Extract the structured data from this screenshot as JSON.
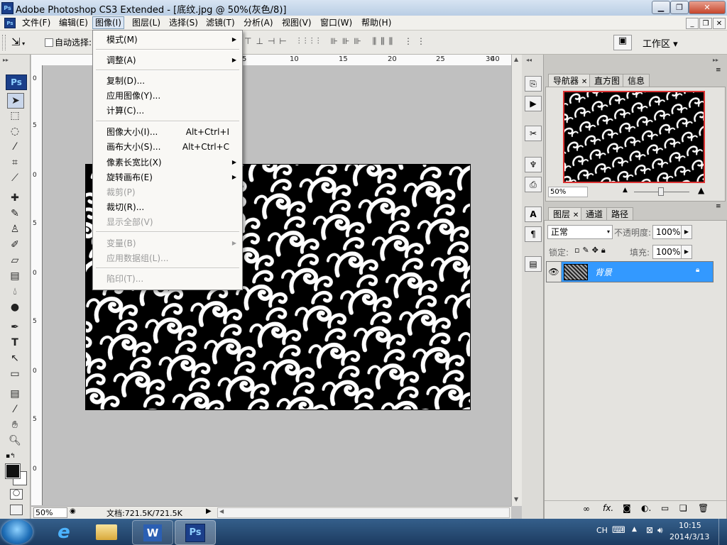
{
  "window": {
    "title": "Adobe Photoshop CS3 Extended - [底纹.jpg @ 50%(灰色/8)]",
    "app_icon": "Ps"
  },
  "menubar": {
    "items": [
      "文件(F)",
      "编辑(E)",
      "图像(I)",
      "图层(L)",
      "选择(S)",
      "滤镜(T)",
      "分析(A)",
      "视图(V)",
      "窗口(W)",
      "帮助(H)"
    ],
    "active": "图像(I)"
  },
  "options": {
    "auto_select_label": "自动选择:",
    "workspace_label": "工作区 ▾"
  },
  "image_menu": {
    "items": [
      {
        "label": "模式(M)",
        "submenu": true,
        "disabled": false,
        "shortcut": ""
      },
      {
        "label": "调整(A)",
        "submenu": true,
        "disabled": false,
        "shortcut": ""
      },
      {
        "label": "复制(D)...",
        "submenu": false,
        "disabled": false,
        "shortcut": ""
      },
      {
        "label": "应用图像(Y)...",
        "submenu": false,
        "disabled": false,
        "shortcut": ""
      },
      {
        "label": "计算(C)...",
        "submenu": false,
        "disabled": false,
        "shortcut": ""
      },
      {
        "label": "图像大小(I)...",
        "submenu": false,
        "disabled": false,
        "shortcut": "Alt+Ctrl+I"
      },
      {
        "label": "画布大小(S)...",
        "submenu": false,
        "disabled": false,
        "shortcut": "Alt+Ctrl+C"
      },
      {
        "label": "像素长宽比(X)",
        "submenu": true,
        "disabled": false,
        "shortcut": ""
      },
      {
        "label": "旋转画布(E)",
        "submenu": true,
        "disabled": false,
        "shortcut": ""
      },
      {
        "label": "裁剪(P)",
        "submenu": false,
        "disabled": true,
        "shortcut": ""
      },
      {
        "label": "裁切(R)...",
        "submenu": false,
        "disabled": false,
        "shortcut": ""
      },
      {
        "label": "显示全部(V)",
        "submenu": false,
        "disabled": true,
        "shortcut": ""
      },
      {
        "label": "变量(B)",
        "submenu": true,
        "disabled": true,
        "shortcut": ""
      },
      {
        "label": "应用数据组(L)...",
        "submenu": false,
        "disabled": true,
        "shortcut": ""
      },
      {
        "label": "陷印(T)...",
        "submenu": false,
        "disabled": true,
        "shortcut": ""
      }
    ]
  },
  "rulers": {
    "top": [
      "5",
      "10",
      "15",
      "20",
      "25",
      "30",
      "35",
      "40"
    ],
    "left": [
      "0",
      "5",
      "0",
      "5",
      "0",
      "5",
      "0",
      "5",
      "0",
      "5",
      "0",
      "2",
      "3",
      "0"
    ]
  },
  "statusbar": {
    "zoom": "50%",
    "doc_info": "文档:721.5K/721.5K"
  },
  "navigator_panel": {
    "tabs": [
      "导航器",
      "直方图",
      "信息"
    ],
    "zoom": "50%"
  },
  "layers_panel": {
    "tabs": [
      "图层",
      "通道",
      "路径"
    ],
    "blend_mode": "正常",
    "opacity_label": "不透明度:",
    "opacity_value": "100%",
    "lock_label": "锁定:",
    "fill_label": "填充:",
    "fill_value": "100%",
    "layers": [
      {
        "name": "背景",
        "visible": true,
        "locked": true,
        "selected": true
      }
    ]
  },
  "taskbar": {
    "ime": "CH",
    "time": "10:15",
    "date": "2014/3/13"
  },
  "colors": {
    "selection_blue": "#3399ff",
    "menu_bg": "#f9f8f5",
    "taskbar": "#234a73"
  }
}
